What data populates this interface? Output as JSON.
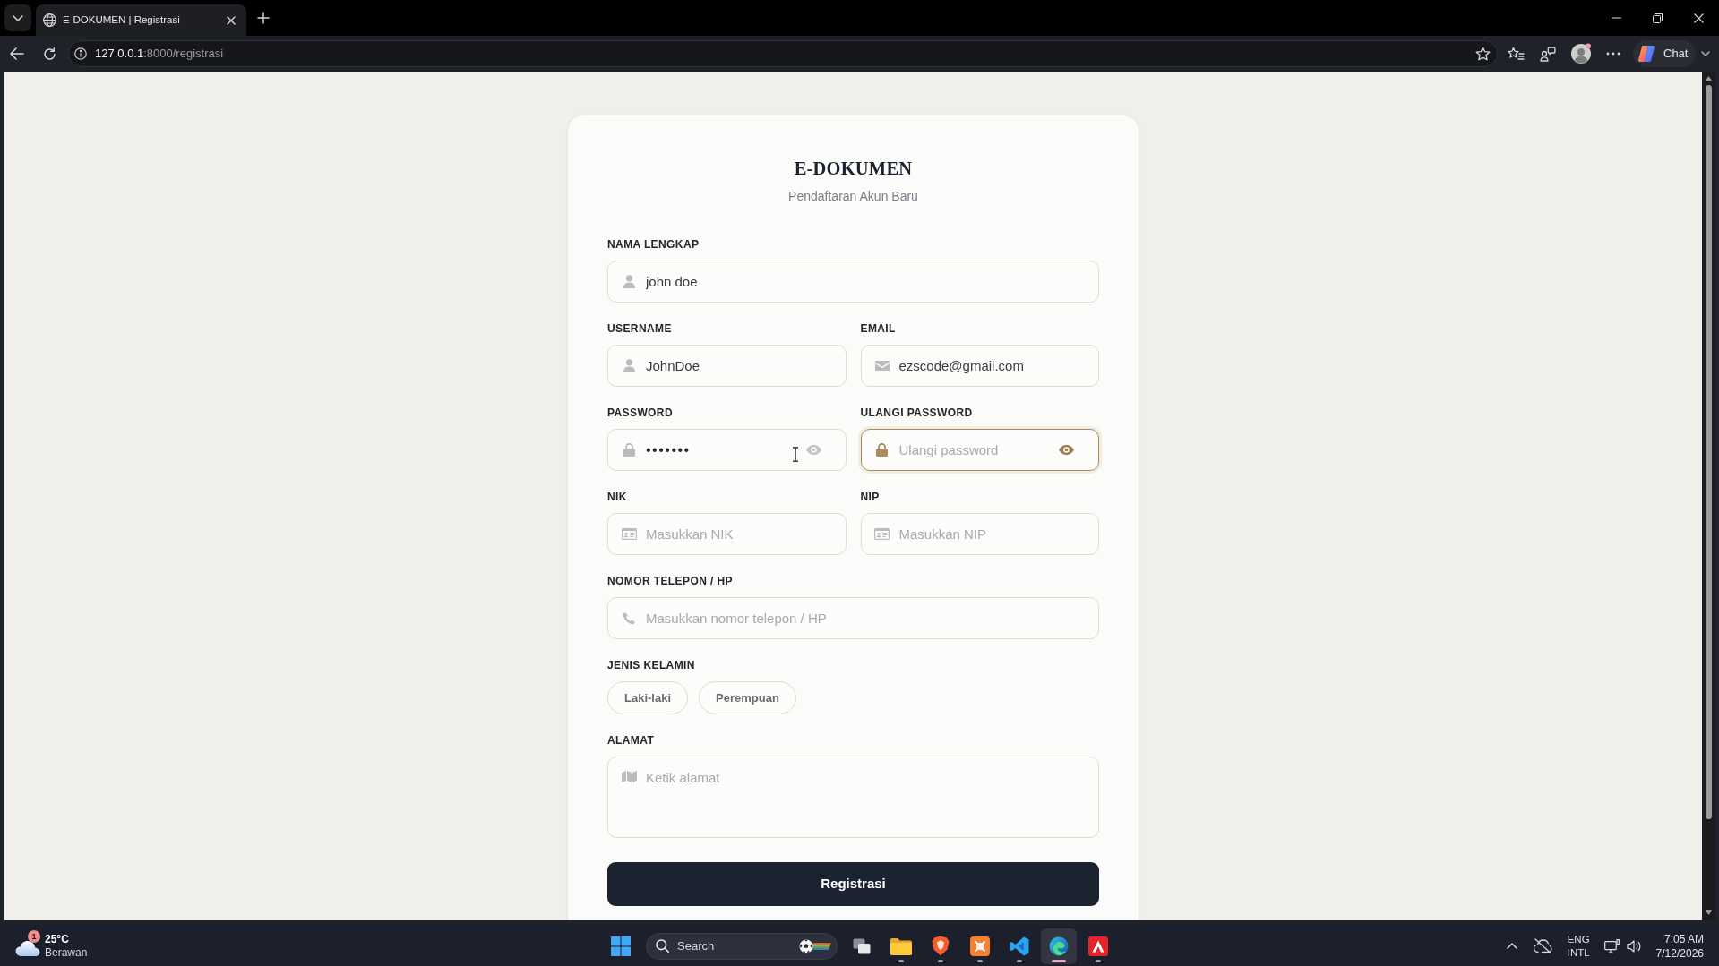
{
  "browser": {
    "tab": {
      "title": "E-DOKUMEN | Registrasi"
    },
    "address": {
      "host": "127.0.0.1",
      "path": ":8000/registrasi"
    },
    "chat_button": {
      "label": "Chat"
    }
  },
  "form": {
    "title": "E-DOKUMEN",
    "subtitle": "Pendaftaran Akun Baru",
    "rows": [
      {
        "fields": [
          {
            "kind": "person",
            "label": "NAMA LENGKAP",
            "value": "john doe",
            "focused": false
          }
        ]
      },
      {
        "fields": [
          {
            "kind": "person",
            "label": "USERNAME",
            "value": "JohnDoe",
            "focused": false
          },
          {
            "kind": "email",
            "label": "EMAIL",
            "value": "ezscode@gmail.com",
            "focused": false
          }
        ]
      },
      {
        "fields": [
          {
            "kind": "password",
            "label": "PASSWORD",
            "value": "•••••••",
            "focused": false
          },
          {
            "kind": "password",
            "label": "ULANGI PASSWORD",
            "placeholder": "Ulangi password",
            "focused": true
          }
        ]
      },
      {
        "fields": [
          {
            "kind": "idcard",
            "label": "NIK",
            "placeholder": "Masukkan NIK",
            "focused": false
          },
          {
            "kind": "idcard",
            "label": "NIP",
            "placeholder": "Masukkan NIP",
            "focused": false
          }
        ]
      },
      {
        "fields": [
          {
            "kind": "phone",
            "label": "NOMOR TELEPON / HP",
            "placeholder": "Masukkan nomor telepon / HP",
            "focused": false
          }
        ]
      },
      {
        "fields": [
          {
            "kind": "choice",
            "label": "JENIS KELAMIN",
            "options": [
              {
                "label": "Laki-laki",
                "selected": false
              },
              {
                "label": "Perempuan",
                "selected": false
              }
            ]
          }
        ]
      },
      {
        "fields": [
          {
            "kind": "address",
            "label": "ALAMAT",
            "placeholder": "Ketik alamat",
            "focused": false
          }
        ]
      }
    ],
    "submit_button": {
      "label": "Registrasi"
    }
  },
  "taskbar": {
    "weather": {
      "badge": "1",
      "temperature": "25°C",
      "condition": "Berawan"
    },
    "search": {
      "label": "Search"
    },
    "apps": [
      {
        "kind": "taskview",
        "running": false,
        "selected": false
      },
      {
        "kind": "folder",
        "running": true,
        "selected": false
      },
      {
        "kind": "shield",
        "running": true,
        "selected": false
      },
      {
        "kind": "crosstile",
        "running": true,
        "selected": false
      },
      {
        "kind": "ribbon",
        "running": true,
        "selected": false
      },
      {
        "kind": "swirl",
        "running": true,
        "selected": true
      },
      {
        "kind": "triangletile",
        "running": true,
        "selected": false
      }
    ],
    "tray": {
      "language": "ENG",
      "layout": "INTL",
      "time": "7:05 AM",
      "date": "7/12/2026"
    }
  }
}
